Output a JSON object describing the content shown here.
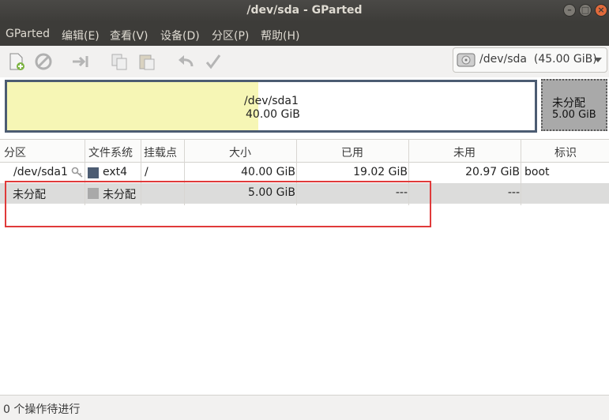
{
  "window": {
    "title": "/dev/sda - GParted"
  },
  "menu": [
    "GParted",
    "编辑(E)",
    "查看(V)",
    "设备(D)",
    "分区(P)",
    "帮助(H)"
  ],
  "toolbar": {
    "icons": [
      "new-partition-icon",
      "delete-icon",
      "resize-move-icon",
      "copy-icon",
      "paste-icon",
      "undo-icon",
      "apply-icon"
    ]
  },
  "device_selector": {
    "label": "/dev/sda  (45.00 GiB)"
  },
  "disk_map": {
    "partition_name": "/dev/sda1",
    "partition_size": "40.00 GiB",
    "unallocated_label": "未分配",
    "unallocated_size": "5.00 GiB",
    "partition_color": "#4c5c72",
    "used_color": "#f6f6b5",
    "used_fraction": 0.4755
  },
  "table": {
    "headers": [
      "分区",
      "文件系统",
      "挂载点",
      "大小",
      "已用",
      "未用",
      "标识"
    ],
    "rows": [
      {
        "partition": "/dev/sda1",
        "filesystem": "ext4",
        "fs_color": "#4c5c72",
        "mount": "/",
        "size": "40.00 GiB",
        "used": "19.02 GiB",
        "unused": "20.97 GiB",
        "flags": "boot"
      },
      {
        "partition": "未分配",
        "filesystem": "未分配",
        "fs_color": "#a9a9a9",
        "mount": "",
        "size": "5.00 GiB",
        "used": "---",
        "unused": "---",
        "flags": ""
      }
    ]
  },
  "status": {
    "text": "0 个操作待进行"
  },
  "colors": {
    "highlight_box": "#e03a3a"
  }
}
